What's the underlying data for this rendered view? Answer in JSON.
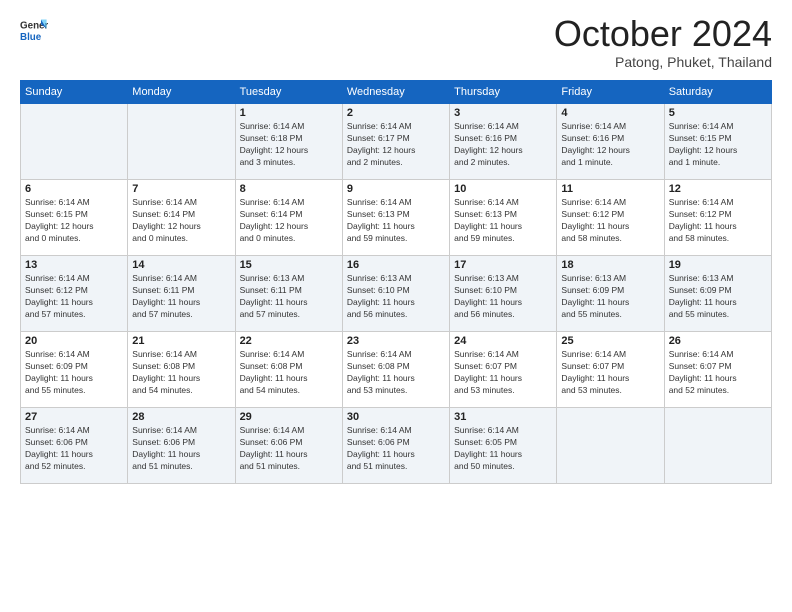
{
  "header": {
    "logo_general": "General",
    "logo_blue": "Blue",
    "month_title": "October 2024",
    "subtitle": "Patong, Phuket, Thailand"
  },
  "days_of_week": [
    "Sunday",
    "Monday",
    "Tuesday",
    "Wednesday",
    "Thursday",
    "Friday",
    "Saturday"
  ],
  "weeks": [
    [
      {
        "day": "",
        "info": ""
      },
      {
        "day": "",
        "info": ""
      },
      {
        "day": "1",
        "info": "Sunrise: 6:14 AM\nSunset: 6:18 PM\nDaylight: 12 hours\nand 3 minutes."
      },
      {
        "day": "2",
        "info": "Sunrise: 6:14 AM\nSunset: 6:17 PM\nDaylight: 12 hours\nand 2 minutes."
      },
      {
        "day": "3",
        "info": "Sunrise: 6:14 AM\nSunset: 6:16 PM\nDaylight: 12 hours\nand 2 minutes."
      },
      {
        "day": "4",
        "info": "Sunrise: 6:14 AM\nSunset: 6:16 PM\nDaylight: 12 hours\nand 1 minute."
      },
      {
        "day": "5",
        "info": "Sunrise: 6:14 AM\nSunset: 6:15 PM\nDaylight: 12 hours\nand 1 minute."
      }
    ],
    [
      {
        "day": "6",
        "info": "Sunrise: 6:14 AM\nSunset: 6:15 PM\nDaylight: 12 hours\nand 0 minutes."
      },
      {
        "day": "7",
        "info": "Sunrise: 6:14 AM\nSunset: 6:14 PM\nDaylight: 12 hours\nand 0 minutes."
      },
      {
        "day": "8",
        "info": "Sunrise: 6:14 AM\nSunset: 6:14 PM\nDaylight: 12 hours\nand 0 minutes."
      },
      {
        "day": "9",
        "info": "Sunrise: 6:14 AM\nSunset: 6:13 PM\nDaylight: 11 hours\nand 59 minutes."
      },
      {
        "day": "10",
        "info": "Sunrise: 6:14 AM\nSunset: 6:13 PM\nDaylight: 11 hours\nand 59 minutes."
      },
      {
        "day": "11",
        "info": "Sunrise: 6:14 AM\nSunset: 6:12 PM\nDaylight: 11 hours\nand 58 minutes."
      },
      {
        "day": "12",
        "info": "Sunrise: 6:14 AM\nSunset: 6:12 PM\nDaylight: 11 hours\nand 58 minutes."
      }
    ],
    [
      {
        "day": "13",
        "info": "Sunrise: 6:14 AM\nSunset: 6:12 PM\nDaylight: 11 hours\nand 57 minutes."
      },
      {
        "day": "14",
        "info": "Sunrise: 6:14 AM\nSunset: 6:11 PM\nDaylight: 11 hours\nand 57 minutes."
      },
      {
        "day": "15",
        "info": "Sunrise: 6:13 AM\nSunset: 6:11 PM\nDaylight: 11 hours\nand 57 minutes."
      },
      {
        "day": "16",
        "info": "Sunrise: 6:13 AM\nSunset: 6:10 PM\nDaylight: 11 hours\nand 56 minutes."
      },
      {
        "day": "17",
        "info": "Sunrise: 6:13 AM\nSunset: 6:10 PM\nDaylight: 11 hours\nand 56 minutes."
      },
      {
        "day": "18",
        "info": "Sunrise: 6:13 AM\nSunset: 6:09 PM\nDaylight: 11 hours\nand 55 minutes."
      },
      {
        "day": "19",
        "info": "Sunrise: 6:13 AM\nSunset: 6:09 PM\nDaylight: 11 hours\nand 55 minutes."
      }
    ],
    [
      {
        "day": "20",
        "info": "Sunrise: 6:14 AM\nSunset: 6:09 PM\nDaylight: 11 hours\nand 55 minutes."
      },
      {
        "day": "21",
        "info": "Sunrise: 6:14 AM\nSunset: 6:08 PM\nDaylight: 11 hours\nand 54 minutes."
      },
      {
        "day": "22",
        "info": "Sunrise: 6:14 AM\nSunset: 6:08 PM\nDaylight: 11 hours\nand 54 minutes."
      },
      {
        "day": "23",
        "info": "Sunrise: 6:14 AM\nSunset: 6:08 PM\nDaylight: 11 hours\nand 53 minutes."
      },
      {
        "day": "24",
        "info": "Sunrise: 6:14 AM\nSunset: 6:07 PM\nDaylight: 11 hours\nand 53 minutes."
      },
      {
        "day": "25",
        "info": "Sunrise: 6:14 AM\nSunset: 6:07 PM\nDaylight: 11 hours\nand 53 minutes."
      },
      {
        "day": "26",
        "info": "Sunrise: 6:14 AM\nSunset: 6:07 PM\nDaylight: 11 hours\nand 52 minutes."
      }
    ],
    [
      {
        "day": "27",
        "info": "Sunrise: 6:14 AM\nSunset: 6:06 PM\nDaylight: 11 hours\nand 52 minutes."
      },
      {
        "day": "28",
        "info": "Sunrise: 6:14 AM\nSunset: 6:06 PM\nDaylight: 11 hours\nand 51 minutes."
      },
      {
        "day": "29",
        "info": "Sunrise: 6:14 AM\nSunset: 6:06 PM\nDaylight: 11 hours\nand 51 minutes."
      },
      {
        "day": "30",
        "info": "Sunrise: 6:14 AM\nSunset: 6:06 PM\nDaylight: 11 hours\nand 51 minutes."
      },
      {
        "day": "31",
        "info": "Sunrise: 6:14 AM\nSunset: 6:05 PM\nDaylight: 11 hours\nand 50 minutes."
      },
      {
        "day": "",
        "info": ""
      },
      {
        "day": "",
        "info": ""
      }
    ]
  ]
}
